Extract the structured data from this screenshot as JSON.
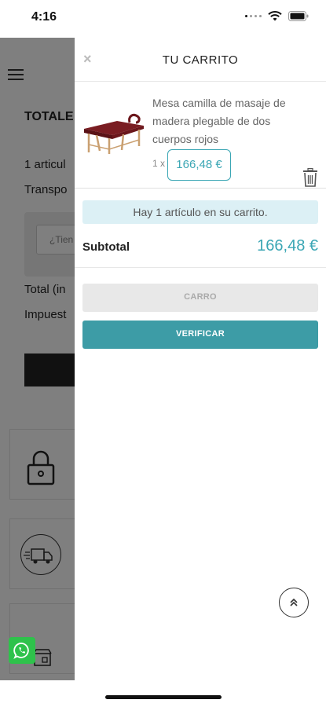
{
  "status_bar": {
    "time": "4:16"
  },
  "background_page": {
    "totals_heading": "TOTALE",
    "line_items": "1 articul",
    "shipping": "Transpo",
    "promo_placeholder": "¿Tien",
    "total_label": "Total (in",
    "tax_label": "Impuest"
  },
  "cart": {
    "title": "TU CARRITO",
    "close_symbol": "×",
    "item": {
      "name": "Mesa camilla de masaje de madera plegable de dos cuerpos rojos",
      "quantity": "1 x",
      "price": "166,48 €"
    },
    "info_message": "Hay 1 artículo en su carrito.",
    "subtotal_label": "Subtotal",
    "subtotal_value": "166,48 €",
    "cart_button": "CARRO",
    "checkout_button": "VERIFICAR"
  },
  "colors": {
    "accent": "#3aa6b4",
    "checkout": "#3d9ca6",
    "banner": "#dcf0f5",
    "whatsapp": "#2ec24b"
  }
}
